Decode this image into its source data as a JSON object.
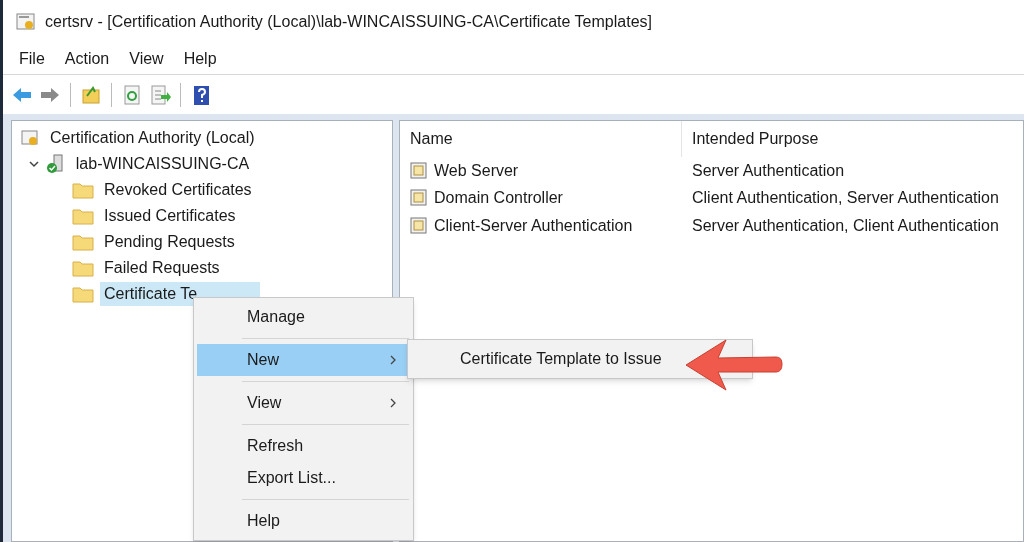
{
  "window": {
    "title": "certsrv - [Certification Authority (Local)\\lab-WINCAISSUING-CA\\Certificate Templates]"
  },
  "menu_bar": [
    "File",
    "Action",
    "View",
    "Help"
  ],
  "toolbar": [
    {
      "kind": "back"
    },
    {
      "kind": "forward"
    },
    {
      "kind": "sep"
    },
    {
      "kind": "up"
    },
    {
      "kind": "sep"
    },
    {
      "kind": "refresh"
    },
    {
      "kind": "export"
    },
    {
      "kind": "sep"
    },
    {
      "kind": "help"
    }
  ],
  "tree": [
    {
      "label": "Certification Authority (Local)",
      "kind": "root",
      "selected": false,
      "children": [
        {
          "label": "lab-WINCAISSUING-CA",
          "kind": "server",
          "expanded": true,
          "selected": false,
          "children": [
            {
              "label": "Revoked Certificates",
              "kind": "folder",
              "selected": false
            },
            {
              "label": "Issued Certificates",
              "kind": "folder",
              "selected": false
            },
            {
              "label": "Pending Requests",
              "kind": "folder",
              "selected": false
            },
            {
              "label": "Failed Requests",
              "kind": "folder",
              "selected": false
            },
            {
              "label": "Certificate Te",
              "kind": "folder",
              "selected": true
            }
          ]
        }
      ]
    }
  ],
  "table": {
    "columns": [
      "Name",
      "Intended Purpose"
    ],
    "rows": [
      [
        "Web Server",
        "Server Authentication"
      ],
      [
        "Domain Controller",
        "Client Authentication, Server Authentication"
      ],
      [
        "Client-Server Authentication",
        "Server Authentication, Client Authentication"
      ]
    ]
  },
  "context_menu": {
    "items": [
      {
        "kind": "item",
        "label": "Manage",
        "selected": false,
        "has_submenu": false
      },
      {
        "kind": "separator"
      },
      {
        "kind": "item",
        "label": "New",
        "selected": true,
        "has_submenu": true
      },
      {
        "kind": "separator"
      },
      {
        "kind": "item",
        "label": "View",
        "selected": false,
        "has_submenu": true
      },
      {
        "kind": "separator"
      },
      {
        "kind": "item",
        "label": "Refresh",
        "selected": false,
        "has_submenu": false
      },
      {
        "kind": "item",
        "label": "Export List...",
        "selected": false,
        "has_submenu": false
      },
      {
        "kind": "separator"
      },
      {
        "kind": "item",
        "label": "Help",
        "selected": false,
        "has_submenu": false
      }
    ]
  },
  "submenu": {
    "items": [
      {
        "label": "Certificate Template to Issue",
        "selected": false
      }
    ]
  }
}
